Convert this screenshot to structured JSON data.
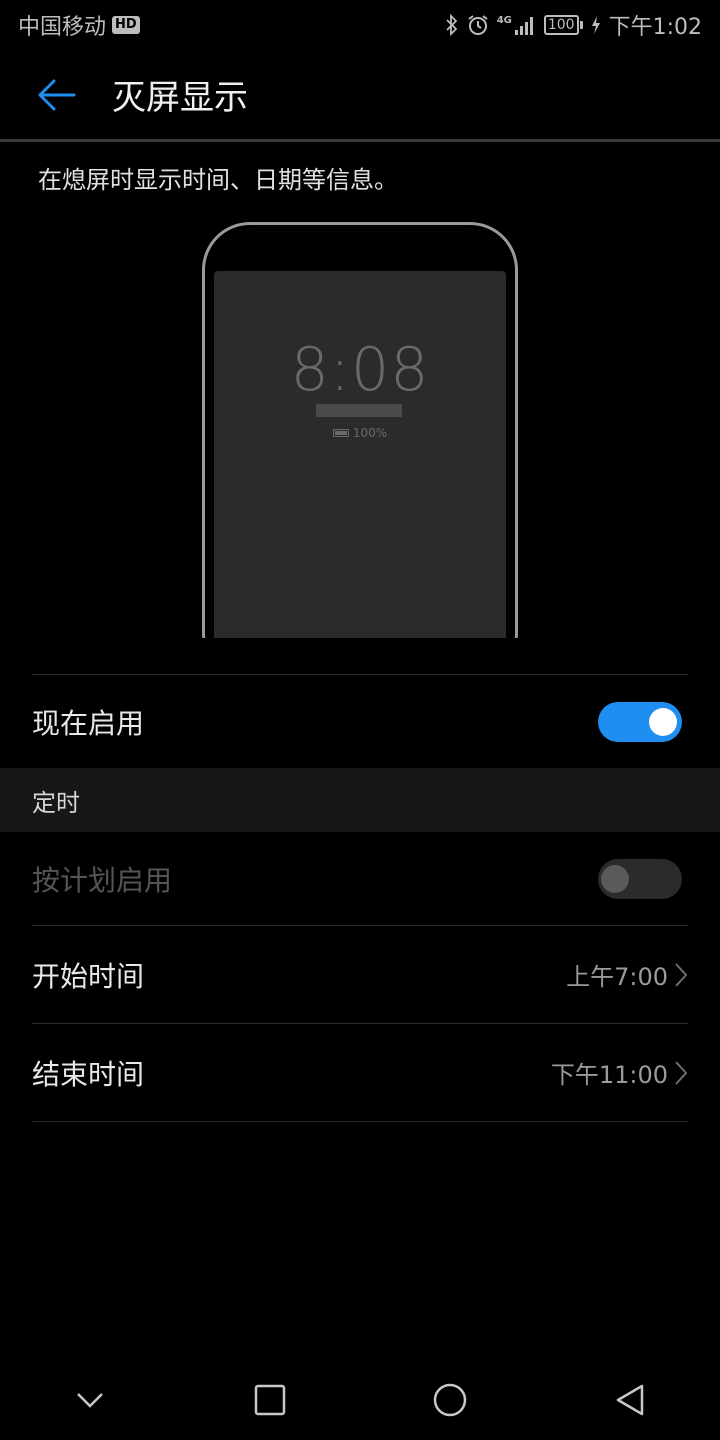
{
  "status_bar": {
    "carrier": "中国移动",
    "hd_badge": "HD",
    "network": "4G",
    "battery_level": "100",
    "time": "下午1:02"
  },
  "header": {
    "title": "灭屏显示"
  },
  "description": "在熄屏时显示时间、日期等信息。",
  "preview": {
    "clock": "8:08",
    "battery": "100%"
  },
  "settings": {
    "enable_now": {
      "label": "现在启用",
      "enabled": true
    },
    "section_title": "定时",
    "scheduled": {
      "label": "按计划启用",
      "enabled": false
    },
    "start_time": {
      "label": "开始时间",
      "value": "上午7:00"
    },
    "end_time": {
      "label": "结束时间",
      "value": "下午11:00"
    }
  },
  "colors": {
    "accent": "#1e8ef0",
    "background": "#000000"
  }
}
